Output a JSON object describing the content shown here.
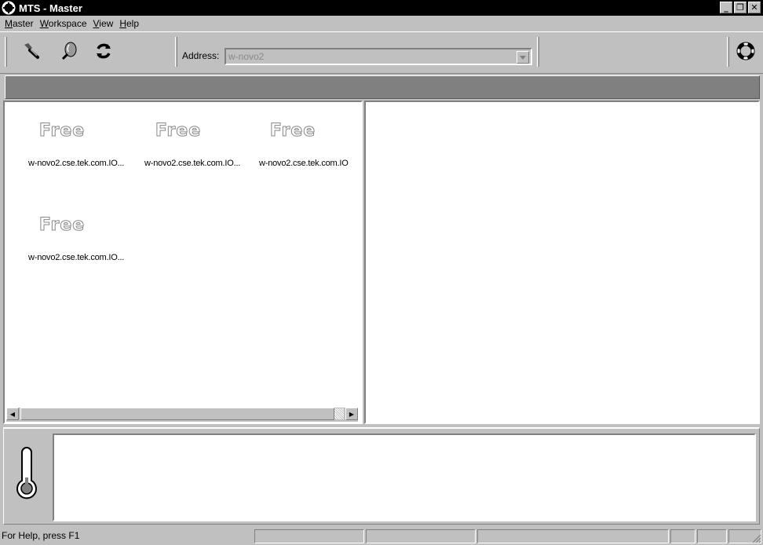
{
  "window": {
    "title": "MTS - Master"
  },
  "menu": {
    "items": [
      "Master",
      "Workspace",
      "View",
      "Help"
    ]
  },
  "toolbar": {
    "buttons": [
      "connect-icon",
      "probe-icon",
      "refresh-icon"
    ],
    "address_label": "Address:",
    "address_value": "w-novo2",
    "help_button": "lifebuoy-icon"
  },
  "machines": [
    {
      "status": "Free",
      "host": "w-novo2.cse.tek.com.IO..."
    },
    {
      "status": "Free",
      "host": "w-novo2.cse.tek.com.IO..."
    },
    {
      "status": "Free",
      "host": "w-novo2.cse.tek.com.IO"
    },
    {
      "status": "Free",
      "host": "w-novo2.cse.tek.com.IO..."
    }
  ],
  "statusbar": {
    "text": "For Help, press F1"
  },
  "colors": {
    "title_bar": "#000000",
    "face": "#c0c0c0",
    "banner": "#808080"
  }
}
